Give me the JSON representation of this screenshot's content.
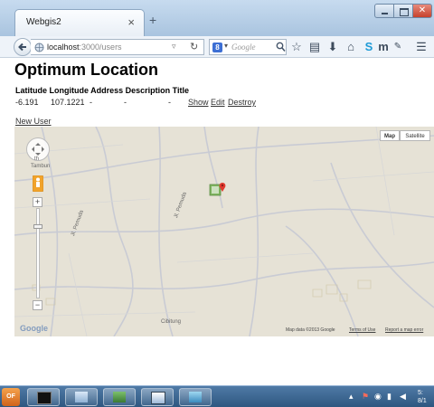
{
  "browser": {
    "tab_title": "Webgis2",
    "tab_close": "×",
    "new_tab": "+",
    "url_host": "localhost",
    "url_path": ":3000/users",
    "search_placeholder": "Google",
    "search_engine_letter": "8",
    "toolbar_icons": [
      "star-icon",
      "bookmarks-icon",
      "download-icon",
      "home-icon",
      "skype-icon",
      "mendeley-icon",
      "extension-icon",
      "menu-icon"
    ]
  },
  "page": {
    "title": "Optimum Location",
    "table_headers": "Latitude Longitude Address Description Title",
    "row": {
      "latitude": "-6.191",
      "longitude": "107.1221",
      "address": "-",
      "description": "-",
      "title": "-",
      "show": "Show",
      "edit": "Edit",
      "destroy": "Destroy"
    },
    "new_user": "New User"
  },
  "map": {
    "type_map": "Map",
    "type_satellite": "Satellite",
    "labels": {
      "north_tambun": "th",
      "tambun": "Tambun",
      "cibitung": "Cibitung",
      "road_1": "Jl. Pemuda",
      "road_2": "Jl. Pemuda"
    },
    "google_logo": "Google",
    "attribution": {
      "map_data": "Map data ©2013 Google",
      "terms": "Terms of Use",
      "report": "Report a map error"
    },
    "zoom_in": "+",
    "zoom_out": "−"
  },
  "taskbar": {
    "start_label": "OF",
    "clock_time": "5:",
    "clock_date": "8/1"
  },
  "colors": {
    "map_bg": "#e6e2d6",
    "road": "#c9cbd4",
    "marker_red": "#e03a2f",
    "taskbar": "#3b6590"
  }
}
